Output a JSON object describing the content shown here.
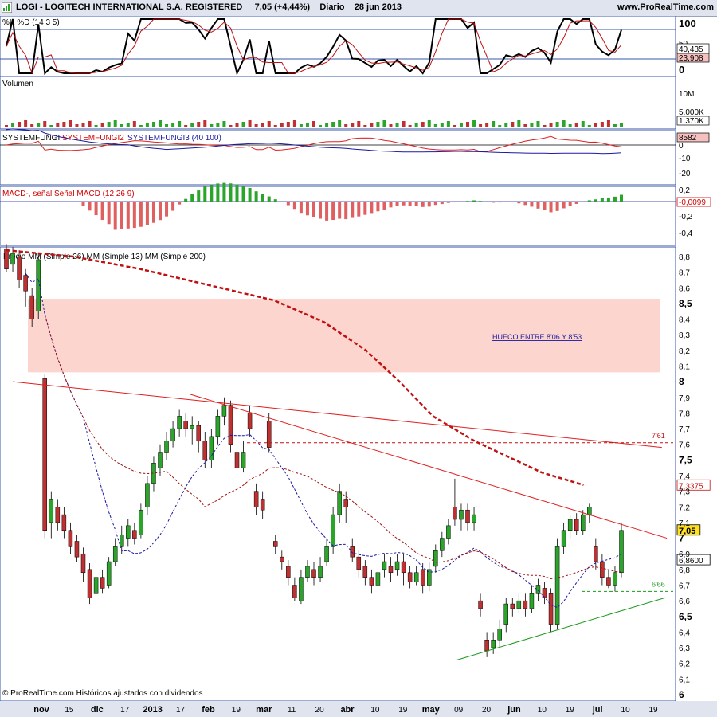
{
  "header": {
    "symbol": "LOGI - LOGITECH INTERNATIONAL S.A. REGISTERED",
    "price_change": "7,05 (+4,44%)",
    "period": "Diario",
    "date": "28 jun 2013",
    "site": "www.ProRealTime.com"
  },
  "footer": {
    "copyright": "© ProRealTime.com  Históricos ajustados con dividendos"
  },
  "colors": {
    "frame": "#3a57a8",
    "panel_border": "#4a5fa8",
    "up": "#2aa52a",
    "down": "#c03030",
    "gap_zone": "#fdd5cf"
  },
  "x_axis": {
    "labels": [
      "nov",
      "15",
      "dic",
      "17",
      "2013",
      "17",
      "feb",
      "19",
      "mar",
      "11",
      "20",
      "abr",
      "10",
      "19",
      "may",
      "09",
      "20",
      "jun",
      "10",
      "19",
      "jul",
      "10",
      "19"
    ],
    "bold": [
      "nov",
      "dic",
      "2013",
      "feb",
      "mar",
      "abr",
      "may",
      "jun",
      "jul"
    ]
  },
  "chart_data": [
    {
      "type": "line",
      "name": "stochastic",
      "label": "%K %D (14 3 5)",
      "ylim": [
        0,
        100
      ],
      "levels": [
        80,
        20
      ],
      "right_labels": [
        "100",
        "50",
        "40,435",
        "23,908",
        "0"
      ],
      "values": {
        "k": 40.435,
        "d": 23.908
      }
    },
    {
      "type": "bar",
      "name": "volume",
      "label": "Volumen",
      "right_labels": [
        "10M",
        "5.000K",
        "1.370K"
      ],
      "last_value": "1.370K"
    },
    {
      "type": "line",
      "name": "systemfungi",
      "labels": [
        "SYSTEMFUNGI",
        "SYSTEMFUNGI2",
        "SYSTEMFUNGI3 (40 100)"
      ],
      "right_labels": [
        "8582",
        "0",
        "-10",
        "-20"
      ]
    },
    {
      "type": "bar",
      "name": "macd",
      "labels": [
        "MACD-, señal Señal MACD (12 26 9)"
      ],
      "right_labels": [
        "0,2",
        "-0,0099",
        "-0,2",
        "-0,4"
      ],
      "last_value": "-0,0099"
    },
    {
      "type": "line",
      "name": "price",
      "label": "Precio  MM (Simple 26)  MM (Simple 13)  MM (Simple 200)",
      "ylim": [
        6.0,
        8.9
      ],
      "y_ticks": [
        "8,8",
        "8,7",
        "8,6",
        "8,5",
        "8,4",
        "8,3",
        "8,2",
        "8,1",
        "8",
        "7,9",
        "7,8",
        "7,7",
        "7,6",
        "7,5",
        "7,4",
        "7,3",
        "7,2",
        "7,1",
        "7",
        "6,9",
        "6,8",
        "6,7",
        "6,6",
        "6,5",
        "6,4",
        "6,3",
        "6,2",
        "6,1",
        "6"
      ],
      "bold_ticks": [
        "8,5",
        "8",
        "7,5",
        "7",
        "6,5",
        "6"
      ],
      "gap_zone": {
        "low": 8.06,
        "high": 8.53,
        "label": "HUECO ENTRE 8'06 Y 8'53"
      },
      "annotations": [
        {
          "text": "7'61",
          "value": 7.61
        },
        {
          "text": "6'66",
          "value": 6.66
        }
      ],
      "price_tags": [
        {
          "text": "7,3375",
          "value": 7.3375,
          "kind": "ma200"
        },
        {
          "text": "7,05",
          "value": 7.05,
          "kind": "last"
        },
        {
          "text": "6,8600",
          "value": 6.86,
          "kind": "ma"
        }
      ],
      "ma200": [
        [
          8.84,
          0
        ],
        [
          8.8,
          40
        ],
        [
          8.72,
          80
        ],
        [
          8.62,
          120
        ],
        [
          8.52,
          160
        ],
        [
          8.38,
          190
        ],
        [
          8.2,
          215
        ],
        [
          8.0,
          235
        ],
        [
          7.78,
          255
        ],
        [
          7.62,
          280
        ],
        [
          7.52,
          300
        ],
        [
          7.42,
          320
        ],
        [
          7.34,
          345
        ]
      ],
      "trendlines": [
        {
          "from": [
            0,
            8.0
          ],
          "to": [
            388,
            7.58
          ],
          "color": "red"
        },
        {
          "from": [
            106,
            7.92
          ],
          "to": [
            391,
            7.0
          ],
          "color": "red"
        },
        {
          "from": [
            265,
            6.22
          ],
          "to": [
            390,
            6.62
          ],
          "color": "green"
        }
      ],
      "levels": [
        {
          "value": 7.61,
          "from": 140,
          "to": 390,
          "color": "red"
        },
        {
          "value": 6.66,
          "from": 340,
          "to": 390,
          "color": "green"
        }
      ],
      "candles": [
        [
          8.85,
          8.72,
          8.88,
          8.7
        ],
        [
          8.75,
          8.82,
          8.86,
          8.7
        ],
        [
          8.8,
          8.65,
          8.84,
          8.6
        ],
        [
          8.68,
          8.58,
          8.72,
          8.48
        ],
        [
          8.55,
          8.4,
          8.6,
          8.35
        ],
        [
          8.45,
          8.78,
          8.82,
          8.4
        ],
        [
          8.02,
          7.05,
          8.05,
          7.0
        ],
        [
          7.1,
          7.25,
          7.3,
          7.0
        ],
        [
          7.2,
          7.1,
          7.25,
          7.05
        ],
        [
          7.15,
          7.05,
          7.2,
          7.0
        ],
        [
          7.05,
          6.95,
          7.1,
          6.9
        ],
        [
          6.98,
          6.88,
          7.02,
          6.85
        ],
        [
          6.9,
          6.78,
          6.94,
          6.72
        ],
        [
          6.8,
          6.62,
          6.84,
          6.58
        ],
        [
          6.65,
          6.75,
          6.8,
          6.6
        ],
        [
          6.75,
          6.68,
          6.8,
          6.65
        ],
        [
          6.7,
          6.85,
          6.88,
          6.68
        ],
        [
          6.85,
          6.95,
          7.0,
          6.82
        ],
        [
          6.95,
          7.02,
          7.08,
          6.9
        ],
        [
          7.0,
          7.08,
          7.12,
          6.95
        ],
        [
          7.05,
          7.0,
          7.1,
          6.96
        ],
        [
          7.02,
          7.18,
          7.22,
          7.0
        ],
        [
          7.2,
          7.35,
          7.4,
          7.15
        ],
        [
          7.35,
          7.48,
          7.52,
          7.3
        ],
        [
          7.45,
          7.55,
          7.6,
          7.4
        ],
        [
          7.55,
          7.62,
          7.68,
          7.5
        ],
        [
          7.62,
          7.7,
          7.75,
          7.58
        ],
        [
          7.7,
          7.78,
          7.82,
          7.65
        ],
        [
          7.75,
          7.7,
          7.8,
          7.65
        ],
        [
          7.7,
          7.72,
          7.78,
          7.6
        ],
        [
          7.72,
          7.62,
          7.75,
          7.55
        ],
        [
          7.62,
          7.5,
          7.68,
          7.45
        ],
        [
          7.5,
          7.65,
          7.7,
          7.45
        ],
        [
          7.65,
          7.78,
          7.82,
          7.6
        ],
        [
          7.78,
          7.85,
          7.9,
          7.72
        ],
        [
          7.85,
          7.6,
          7.88,
          7.55
        ],
        [
          7.55,
          7.45,
          7.6,
          7.4
        ],
        [
          7.45,
          7.55,
          7.62,
          7.42
        ],
        [
          7.8,
          7.7,
          7.85,
          7.65
        ],
        [
          7.3,
          7.2,
          7.35,
          7.15
        ],
        [
          7.25,
          7.18,
          7.3,
          7.12
        ],
        [
          7.75,
          7.58,
          7.8,
          7.55
        ],
        [
          6.98,
          6.95,
          7.02,
          6.9
        ],
        [
          6.88,
          6.85,
          6.92,
          6.8
        ],
        [
          6.82,
          6.75,
          6.86,
          6.7
        ],
        [
          6.7,
          6.62,
          6.75,
          6.6
        ],
        [
          6.6,
          6.75,
          6.8,
          6.58
        ],
        [
          6.75,
          6.82,
          6.86,
          6.72
        ],
        [
          6.8,
          6.75,
          6.85,
          6.7
        ],
        [
          6.75,
          6.82,
          6.88,
          6.72
        ],
        [
          6.85,
          6.95,
          7.0,
          6.82
        ],
        [
          6.95,
          7.15,
          7.2,
          6.9
        ],
        [
          7.15,
          7.3,
          7.35,
          7.1
        ],
        [
          7.25,
          7.2,
          7.3,
          7.1
        ],
        [
          6.95,
          6.88,
          7.0,
          6.85
        ],
        [
          6.88,
          6.8,
          6.92,
          6.75
        ],
        [
          6.82,
          6.75,
          6.86,
          6.7
        ],
        [
          6.75,
          6.7,
          6.8,
          6.65
        ],
        [
          6.7,
          6.78,
          6.82,
          6.66
        ],
        [
          6.8,
          6.85,
          6.9,
          6.75
        ],
        [
          6.82,
          6.78,
          6.88,
          6.72
        ],
        [
          6.8,
          6.85,
          6.9,
          6.76
        ],
        [
          6.85,
          6.78,
          6.9,
          6.7
        ],
        [
          6.78,
          6.72,
          6.82,
          6.68
        ],
        [
          6.72,
          6.78,
          6.82,
          6.7
        ],
        [
          6.8,
          6.7,
          6.84,
          6.65
        ],
        [
          6.7,
          6.8,
          6.85,
          6.66
        ],
        [
          6.82,
          6.92,
          6.96,
          6.78
        ],
        [
          6.92,
          7.0,
          7.04,
          6.88
        ],
        [
          7.0,
          7.08,
          7.12,
          6.96
        ],
        [
          7.2,
          7.12,
          7.38,
          7.08
        ],
        [
          7.12,
          7.18,
          7.22,
          7.05
        ],
        [
          7.18,
          7.1,
          7.22,
          7.05
        ],
        [
          7.1,
          7.15,
          7.2,
          7.05
        ],
        [
          6.6,
          6.55,
          6.65,
          6.5
        ],
        [
          6.35,
          6.28,
          6.4,
          6.24
        ],
        [
          6.3,
          6.35,
          6.4,
          6.26
        ],
        [
          6.35,
          6.42,
          6.48,
          6.3
        ],
        [
          6.45,
          6.58,
          6.62,
          6.4
        ],
        [
          6.58,
          6.55,
          6.62,
          6.5
        ],
        [
          6.55,
          6.6,
          6.65,
          6.52
        ],
        [
          6.6,
          6.55,
          6.65,
          6.5
        ],
        [
          6.55,
          6.65,
          6.7,
          6.52
        ],
        [
          6.65,
          6.7,
          6.74,
          6.6
        ],
        [
          6.68,
          6.62,
          6.72,
          6.58
        ],
        [
          6.65,
          6.45,
          6.68,
          6.4
        ],
        [
          6.45,
          6.95,
          7.0,
          6.42
        ],
        [
          6.95,
          7.05,
          7.1,
          6.9
        ],
        [
          7.05,
          7.12,
          7.15,
          7.0
        ],
        [
          7.12,
          7.05,
          7.16,
          7.02
        ],
        [
          7.05,
          7.15,
          7.18,
          7.02
        ],
        [
          7.15,
          7.2,
          7.22,
          7.1
        ],
        [
          6.95,
          6.85,
          7.0,
          6.8
        ],
        [
          6.85,
          6.75,
          6.9,
          6.7
        ],
        [
          6.75,
          6.7,
          6.8,
          6.68
        ],
        [
          6.7,
          6.78,
          6.82,
          6.66
        ],
        [
          6.78,
          7.05,
          7.1,
          6.75
        ]
      ],
      "legend": [
        "Precio",
        "MM (Simple 26)",
        "MM (Simple 13)",
        "MM (Simple 200)"
      ]
    }
  ]
}
